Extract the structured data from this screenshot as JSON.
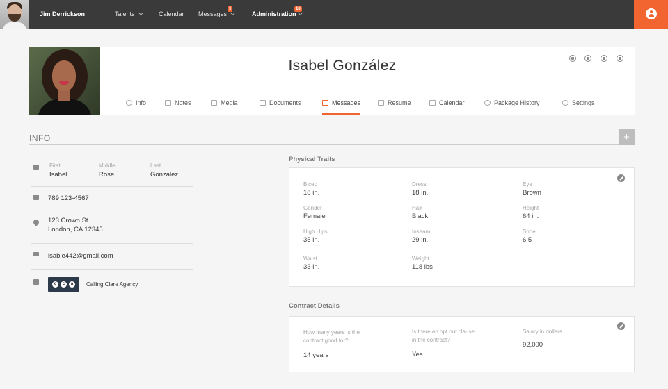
{
  "topnav": {
    "username": "Jim Derrickson",
    "items": [
      {
        "label": "Talents",
        "has_chevron": true
      },
      {
        "label": "Calendar",
        "has_chevron": false
      },
      {
        "label": "Messages",
        "has_chevron": true,
        "badge": "3"
      },
      {
        "label": "Administration",
        "has_chevron": true,
        "badge": "18"
      }
    ]
  },
  "profile": {
    "name": "Isabel González",
    "action_icons": [
      "pdf-icon",
      "document-icon",
      "edit-icon",
      "delete-icon"
    ],
    "tabs": [
      {
        "label": "Info",
        "icon": "info-icon"
      },
      {
        "label": "Notes",
        "icon": "notes-icon"
      },
      {
        "label": "Media",
        "icon": "media-icon"
      },
      {
        "label": "Documents",
        "icon": "folder-icon"
      },
      {
        "label": "Messages",
        "icon": "envelope-icon",
        "active": true
      },
      {
        "label": "Resume",
        "icon": "resume-icon"
      },
      {
        "label": "Calendar",
        "icon": "calendar-icon"
      },
      {
        "label": "Package History",
        "icon": "history-icon"
      },
      {
        "label": "Settings",
        "icon": "gear-icon"
      }
    ]
  },
  "info": {
    "title": "INFO",
    "add_label": "+",
    "name_fields": [
      {
        "label": "First",
        "value": "Isabel"
      },
      {
        "label": "Middle",
        "value": "Rose"
      },
      {
        "label": "Last",
        "value": "Gonzalez"
      }
    ],
    "phone": "789 123-4567",
    "address_line1": "123 Crown St.",
    "address_line2": "London, CA 12345",
    "email": "isable442@gmail.com",
    "agency": {
      "logo_letters": [
        "c",
        "c",
        "a"
      ],
      "name": "Calling Clare Agency"
    }
  },
  "physical_traits": {
    "title": "Physical  Traits",
    "traits": [
      {
        "label": "Bicep",
        "value": "18 in."
      },
      {
        "label": "Dress",
        "value": "18 in."
      },
      {
        "label": "Eye",
        "value": "Brown"
      },
      {
        "label": "Gender",
        "value": "Female"
      },
      {
        "label": "Hair",
        "value": "Black"
      },
      {
        "label": "Height",
        "value": "64 in."
      },
      {
        "label": "High Hips",
        "value": "35 in."
      },
      {
        "label": "Inseam",
        "value": "29 in."
      },
      {
        "label": "Shoe",
        "value": "6.5"
      },
      {
        "label": "Waist",
        "value": "33 in."
      },
      {
        "label": "Weight",
        "value": "118 lbs"
      }
    ]
  },
  "contract": {
    "title": "Contract Details",
    "fields": [
      {
        "label_line1": "How many years is the",
        "label_line2": "contract good for?",
        "value": "14 years"
      },
      {
        "label_line1": "Is there an opt out clause",
        "label_line2": "in the contract?",
        "value": "Yes"
      },
      {
        "label_line1": "Salary in dollars",
        "label_line2": "",
        "value": "92,000"
      }
    ]
  },
  "colors": {
    "accent": "#f26530",
    "topbar": "#3a3a3a",
    "background": "#f5f5f5"
  }
}
